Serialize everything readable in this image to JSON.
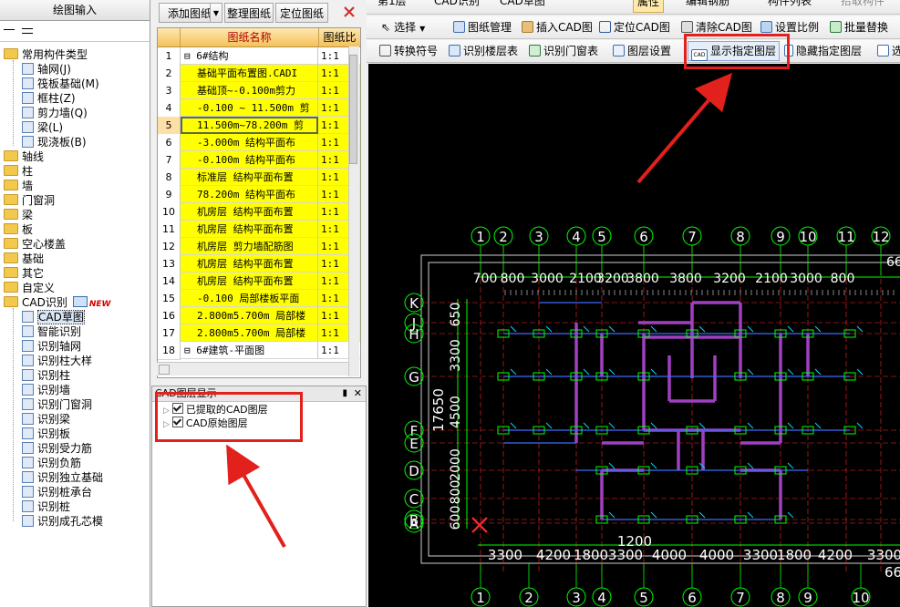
{
  "left_panel": {
    "title": "绘图输入",
    "tree": [
      {
        "label": "常用构件类型",
        "type": "folder"
      },
      {
        "label": "轴网(J)",
        "type": "item"
      },
      {
        "label": "筏板基础(M)",
        "type": "item"
      },
      {
        "label": "框柱(Z)",
        "type": "item"
      },
      {
        "label": "剪力墙(Q)",
        "type": "item"
      },
      {
        "label": "梁(L)",
        "type": "item"
      },
      {
        "label": "现浇板(B)",
        "type": "item"
      },
      {
        "label": "轴线",
        "type": "folder"
      },
      {
        "label": "柱",
        "type": "folder"
      },
      {
        "label": "墙",
        "type": "folder"
      },
      {
        "label": "门窗洞",
        "type": "folder"
      },
      {
        "label": "梁",
        "type": "folder"
      },
      {
        "label": "板",
        "type": "folder"
      },
      {
        "label": "空心楼盖",
        "type": "folder"
      },
      {
        "label": "基础",
        "type": "folder"
      },
      {
        "label": "其它",
        "type": "folder"
      },
      {
        "label": "自定义",
        "type": "folder"
      },
      {
        "label": "CAD识别",
        "type": "folder",
        "badge": "NEW"
      },
      {
        "label": "CAD草图",
        "type": "item",
        "selected": true
      },
      {
        "label": "智能识别",
        "type": "item"
      },
      {
        "label": "识别轴网",
        "type": "item"
      },
      {
        "label": "识别柱大样",
        "type": "item"
      },
      {
        "label": "识别柱",
        "type": "item"
      },
      {
        "label": "识别墙",
        "type": "item"
      },
      {
        "label": "识别门窗洞",
        "type": "item"
      },
      {
        "label": "识别梁",
        "type": "item"
      },
      {
        "label": "识别板",
        "type": "item"
      },
      {
        "label": "识别受力筋",
        "type": "item"
      },
      {
        "label": "识别负筋",
        "type": "item"
      },
      {
        "label": "识别独立基础",
        "type": "item"
      },
      {
        "label": "识别桩承台",
        "type": "item"
      },
      {
        "label": "识别桩",
        "type": "item"
      },
      {
        "label": "识别成孔芯模",
        "type": "item"
      }
    ]
  },
  "drawing_panel": {
    "buttons": {
      "add": "添加图纸",
      "organize": "整理图纸",
      "locate": "定位图纸"
    },
    "columns": {
      "name": "图纸名称",
      "scale": "图纸比"
    },
    "rows": [
      {
        "n": "1",
        "name": "⊟ 6#结构",
        "scale": "1:1",
        "hl": false
      },
      {
        "n": "2",
        "name": "基础平面布置图.CADI",
        "scale": "1:1",
        "hl": true
      },
      {
        "n": "3",
        "name": "基础顶~-0.100m剪力",
        "scale": "1:1",
        "hl": true
      },
      {
        "n": "4",
        "name": "-0.100 ~ 11.500m 剪",
        "scale": "1:1",
        "hl": true
      },
      {
        "n": "5",
        "name": "11.500m~78.200m 剪",
        "scale": "1:1",
        "hl": true,
        "selected": true
      },
      {
        "n": "6",
        "name": "-3.000m 结构平面布",
        "scale": "1:1",
        "hl": true
      },
      {
        "n": "7",
        "name": "-0.100m 结构平面布",
        "scale": "1:1",
        "hl": true
      },
      {
        "n": "8",
        "name": "标准层 结构平面布置",
        "scale": "1:1",
        "hl": true
      },
      {
        "n": "9",
        "name": "78.200m 结构平面布",
        "scale": "1:1",
        "hl": true
      },
      {
        "n": "10",
        "name": "机房层 结构平面布置",
        "scale": "1:1",
        "hl": true
      },
      {
        "n": "11",
        "name": "机房层 结构平面布置",
        "scale": "1:1",
        "hl": true
      },
      {
        "n": "12",
        "name": "机房层 剪力墙配筋图",
        "scale": "1:1",
        "hl": true
      },
      {
        "n": "13",
        "name": "机房层 结构平面布置",
        "scale": "1:1",
        "hl": true
      },
      {
        "n": "14",
        "name": "机房层 结构平面布置",
        "scale": "1:1",
        "hl": true
      },
      {
        "n": "15",
        "name": "-0.100 局部楼板平面",
        "scale": "1:1",
        "hl": true
      },
      {
        "n": "16",
        "name": "2.800m5.700m 局部楼",
        "scale": "1:1",
        "hl": true
      },
      {
        "n": "17",
        "name": "2.800m5.700m 局部楼",
        "scale": "1:1",
        "hl": true
      },
      {
        "n": "18",
        "name": "⊟ 6#建筑-平面图",
        "scale": "1:1",
        "hl": false
      }
    ]
  },
  "layer_panel": {
    "title": "CAD图层显示",
    "items": [
      {
        "label": "已提取的CAD图层"
      },
      {
        "label": "CAD原始图层"
      }
    ]
  },
  "toolbar_top": {
    "floor": "第1层",
    "mode": "CAD识别",
    "sub": "CAD草图",
    "properties": "属性",
    "edit_rebar": "编辑钢筋",
    "component_list": "构件列表",
    "pick_component": "拾取构件"
  },
  "toolbar_2": {
    "select": "选择",
    "drawing_mgmt": "图纸管理",
    "insert_cad": "插入CAD图",
    "locate_cad": "定位CAD图",
    "clear_cad": "清除CAD图",
    "set_scale": "设置比例",
    "batch_replace": "批量替换"
  },
  "toolbar_3": {
    "convert_symbol": "转换符号",
    "identify_floor_table": "识别楼层表",
    "identify_door_window_table": "识别门窗表",
    "layer_settings": "图层设置",
    "show_layer": "显示指定图层",
    "hide_layer": "隐藏指定图层",
    "select_layer": "选"
  },
  "cad": {
    "axes_top": [
      "1",
      "2",
      "3",
      "4",
      "5",
      "6",
      "7",
      "8",
      "9",
      "10",
      "11",
      "12"
    ],
    "axes_bottom": [
      "1",
      "2",
      "3",
      "4",
      "5",
      "6",
      "7",
      "8",
      "9",
      "10"
    ],
    "axes_left": [
      "K",
      "J",
      "H",
      "G",
      "F",
      "E",
      "D",
      "C",
      "B",
      "A"
    ],
    "dims_top": [
      "700",
      "800",
      "3000",
      "2100",
      "3200",
      "3800",
      "3800",
      "3200",
      "2100",
      "3000",
      "800"
    ],
    "dims_bottom": [
      "3300",
      "4200",
      "1800",
      "3300",
      "4000",
      "4000",
      "3300",
      "1800",
      "4200",
      "3300"
    ],
    "dims_left": [
      "650",
      "3300",
      "4500",
      "2000",
      "800",
      "600"
    ],
    "total_height": "17650",
    "dim_misc_bottom": "1200",
    "dim_right_top": "66",
    "dim_right_bottom": "66"
  },
  "colors": {
    "accent_red": "#e2201c",
    "row_yellow": "#ffff00",
    "canvas": "#000000",
    "axis_green": "#00ff00",
    "wall_purple": "#a040c0"
  }
}
